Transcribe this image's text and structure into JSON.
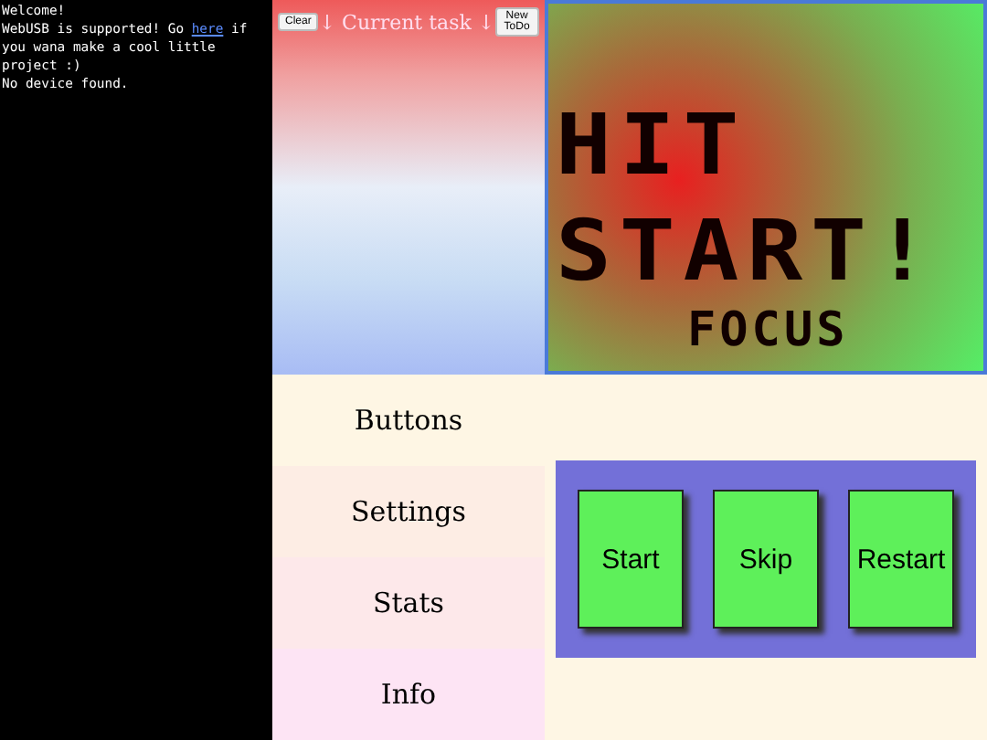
{
  "console": {
    "lines": [
      {
        "text": "Welcome!"
      },
      {
        "text": "WebUSB is supported! Go ",
        "link": "here",
        "after": " if you wana make a cool little project :)"
      },
      {
        "text": "No device found."
      }
    ]
  },
  "task_panel": {
    "clear_button": "Clear",
    "title": "↓ Current task ↓",
    "new_button": "New ToDo"
  },
  "timer": {
    "headline_1": "HIT",
    "headline_2": "START!",
    "mode": "FOCUS"
  },
  "menu": [
    {
      "label": "Buttons"
    },
    {
      "label": "Settings"
    },
    {
      "label": "Stats"
    },
    {
      "label": "Info"
    }
  ],
  "controls": [
    "Start",
    "Skip",
    "Restart"
  ]
}
